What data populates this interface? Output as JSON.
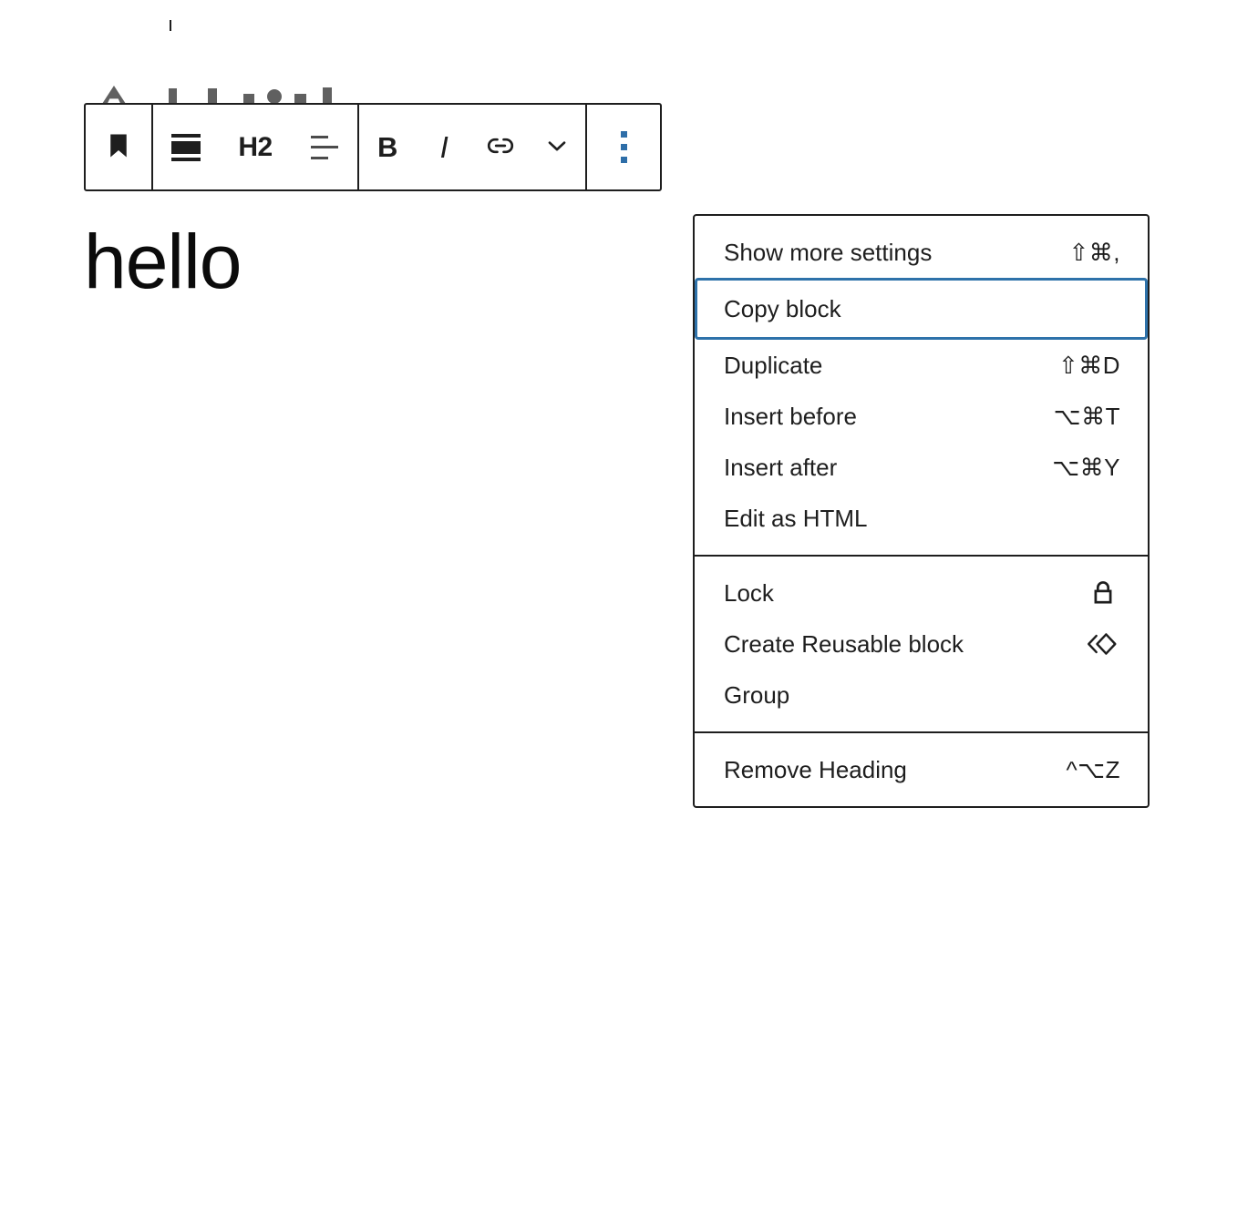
{
  "editor": {
    "heading_text": "hello",
    "toolbar": {
      "block_type_label": "block-bookmark-icon",
      "heading_level_label": "H2",
      "align_label": "align-text-icon",
      "bold_label": "B",
      "italic_label": "I",
      "link_label": "link-icon",
      "more_rich_text_label": "chevron-down-icon",
      "options_label": "more-options-icon"
    },
    "ghost_toolbar_icons": [
      "letter-a-icon",
      "bar-icon-1",
      "bar-icon-2",
      "bar-icon-3",
      "dot-icon",
      "bar-icon-4",
      "bar-icon-5"
    ]
  },
  "block_options_menu": {
    "sections": [
      {
        "items": [
          {
            "label": "Show more settings",
            "shortcut": "⇧⌘,",
            "icon": ""
          },
          {
            "label": "Copy block",
            "shortcut": "",
            "icon": "",
            "focused": true
          },
          {
            "label": "Duplicate",
            "shortcut": "⇧⌘D",
            "icon": ""
          },
          {
            "label": "Insert before",
            "shortcut": "⌥⌘T",
            "icon": ""
          },
          {
            "label": "Insert after",
            "shortcut": "⌥⌘Y",
            "icon": ""
          },
          {
            "label": "Edit as HTML",
            "shortcut": "",
            "icon": ""
          }
        ]
      },
      {
        "items": [
          {
            "label": "Lock",
            "shortcut": "",
            "icon": "lock-icon"
          },
          {
            "label": "Create Reusable block",
            "shortcut": "",
            "icon": "reusable-block-icon"
          },
          {
            "label": "Group",
            "shortcut": "",
            "icon": ""
          }
        ]
      },
      {
        "items": [
          {
            "label": "Remove Heading",
            "shortcut": "^⌥Z",
            "icon": ""
          }
        ]
      }
    ]
  },
  "colors": {
    "accent_blue": "#2e6ea8",
    "focus_blue": "#2e72aa",
    "border_dark": "#1e1e1e",
    "text": "#1e1e1e",
    "ghost_gray": "#606060"
  }
}
